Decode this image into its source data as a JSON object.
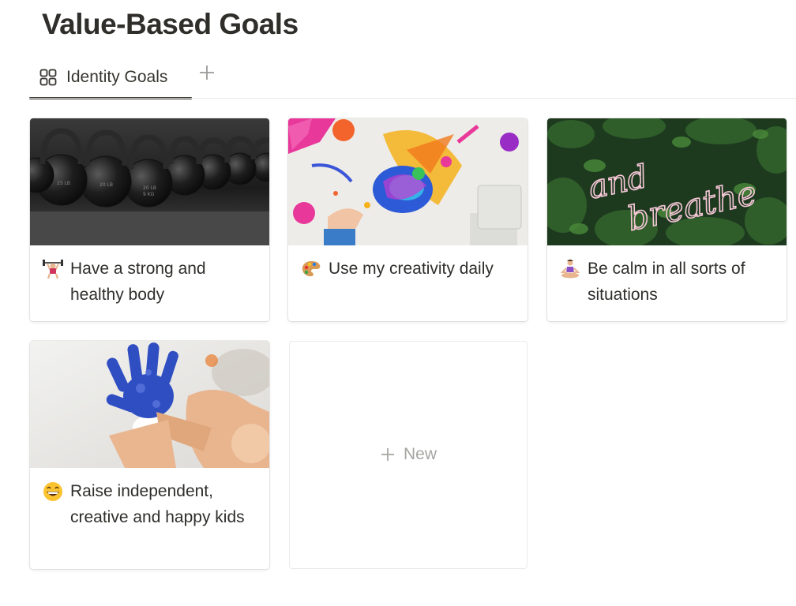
{
  "page": {
    "title": "Value-Based Goals"
  },
  "tabs": [
    {
      "label": "Identity Goals",
      "icon": "gallery-grid-icon",
      "active": true
    }
  ],
  "add_view_icon": "plus-icon",
  "cards": [
    {
      "title": "Have a strong and healthy body",
      "emoji": "weightlifter-emoji",
      "cover": "kettlebells-photo"
    },
    {
      "title": "Use my creativity daily",
      "emoji": "artist-palette-emoji",
      "cover": "paint-splatter-photo"
    },
    {
      "title": "Be calm in all sorts of situations",
      "emoji": "meditating-person-emoji",
      "cover": "and-breathe-neon-sign-photo"
    },
    {
      "title": "Raise independent, creative and happy kids",
      "emoji": "grinning-face-emoji",
      "cover": "painted-child-hand-photo"
    }
  ],
  "new_card": {
    "label": "New",
    "icon": "plus-icon"
  },
  "colors": {
    "text": "#37352f",
    "muted": "#a6a5a2",
    "border": "#e9e9e7",
    "neon": "#f7c8d8"
  }
}
